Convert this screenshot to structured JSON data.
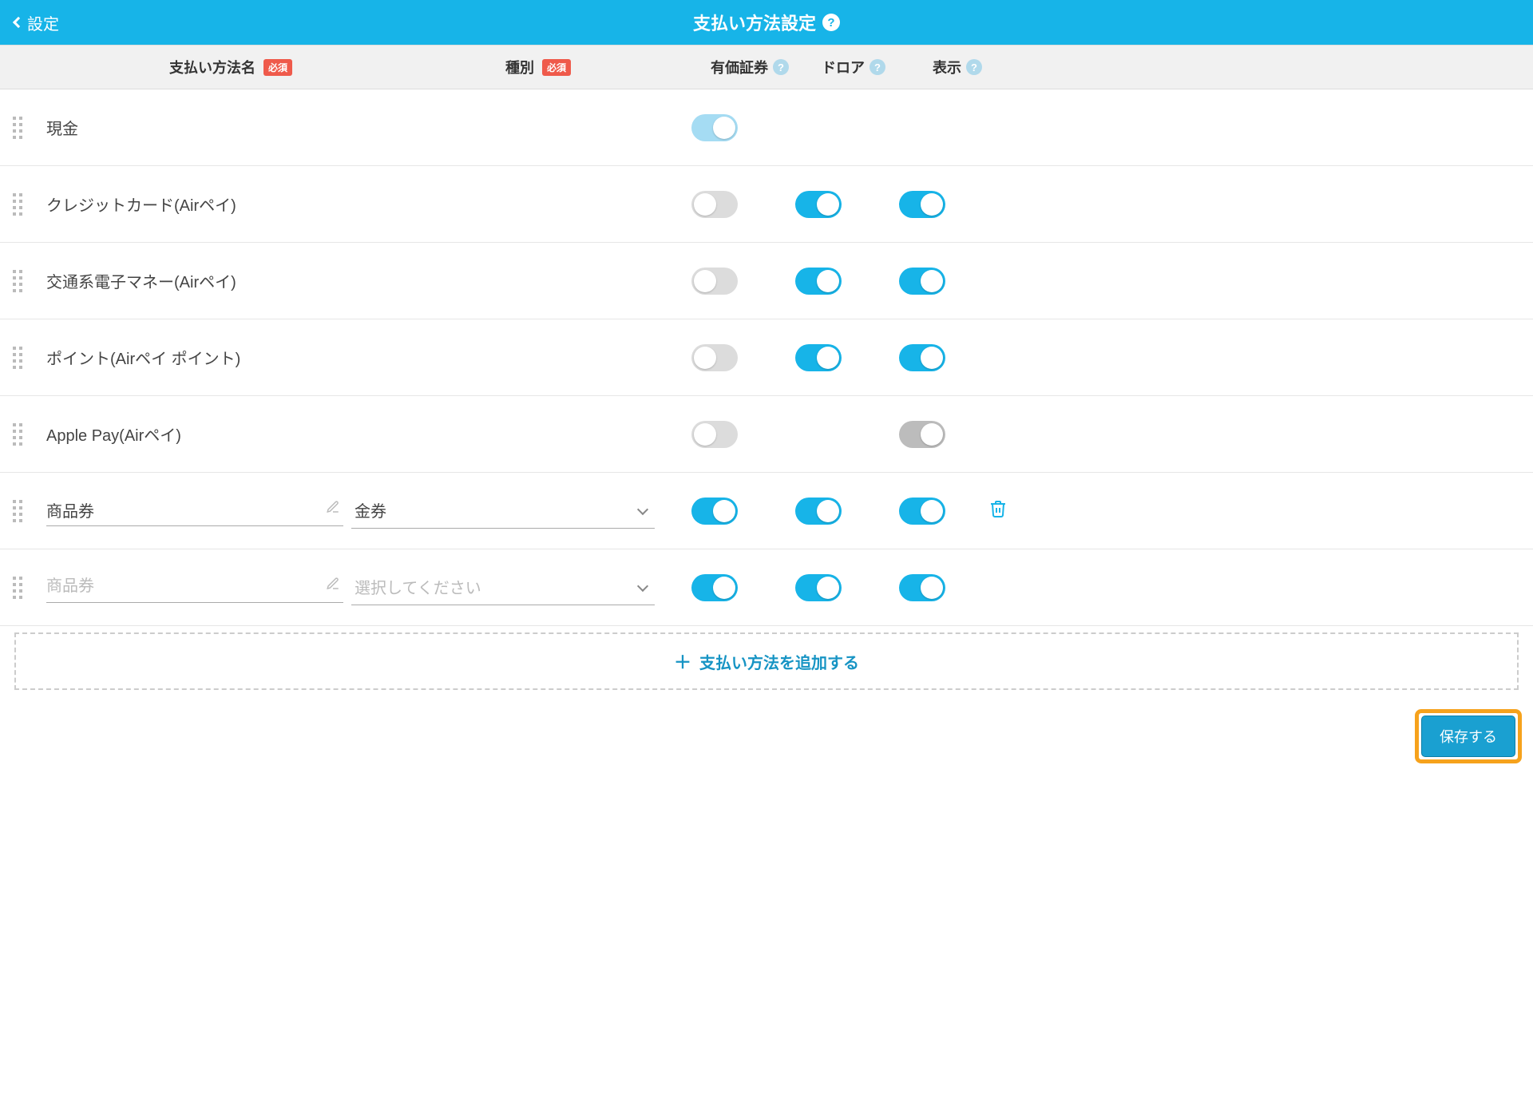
{
  "header": {
    "back_label": "設定",
    "title": "支払い方法設定"
  },
  "columns": {
    "name": "支払い方法名",
    "type": "種別",
    "securities": "有価証券",
    "drawer": "ドロア",
    "display": "表示",
    "required_badge": "必須"
  },
  "rows": [
    {
      "name": "現金",
      "type": null,
      "editable": false,
      "securities": "on-disabled",
      "drawer": null,
      "display": null,
      "deletable": false
    },
    {
      "name": "クレジットカード(Airペイ)",
      "type": null,
      "editable": false,
      "securities": "off",
      "drawer": "on",
      "display": "on",
      "deletable": false
    },
    {
      "name": "交通系電子マネー(Airペイ)",
      "type": null,
      "editable": false,
      "securities": "off",
      "drawer": "on",
      "display": "on",
      "deletable": false
    },
    {
      "name": "ポイント(Airペイ ポイント)",
      "type": null,
      "editable": false,
      "securities": "off",
      "drawer": "on",
      "display": "on",
      "deletable": false
    },
    {
      "name": "Apple Pay(Airペイ)",
      "type": null,
      "editable": false,
      "securities": "off",
      "drawer": null,
      "display": "off-disabled",
      "deletable": false
    },
    {
      "name": "商品券",
      "type": "金券",
      "editable": true,
      "securities": "on",
      "drawer": "on",
      "display": "on",
      "deletable": true
    },
    {
      "name": "",
      "type": "",
      "editable": true,
      "securities": "on",
      "drawer": "on",
      "display": "on",
      "deletable": false
    }
  ],
  "inputs": {
    "name_placeholder": "商品券",
    "type_placeholder": "選択してください"
  },
  "actions": {
    "add_label": "支払い方法を追加する",
    "save_label": "保存する"
  }
}
